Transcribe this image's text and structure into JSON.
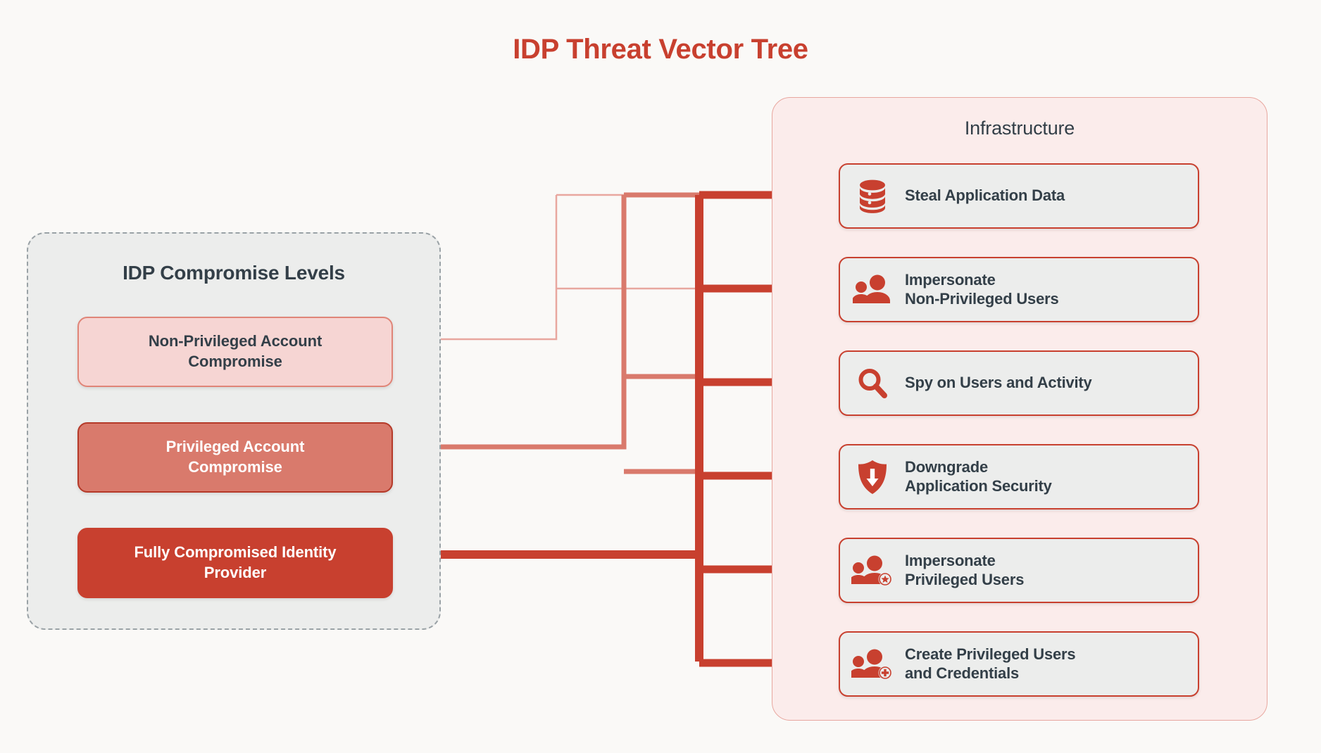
{
  "page": {
    "title": "IDP Threat Vector Tree",
    "background_color": "#faf9f7",
    "accent_color": "#c8402f",
    "text_color": "#333f48"
  },
  "levels_panel": {
    "title": "IDP Compromise Levels",
    "border_style": "dashed",
    "fill_color": "#ecedec",
    "items": [
      {
        "id": "non-privileged-account-compromise",
        "label": "Non-Privileged Account\nCompromise",
        "fill_color": "#f6d5d3",
        "border_color": "#e08578",
        "text_color": "#333f48",
        "severity": 1
      },
      {
        "id": "privileged-account-compromise",
        "label": "Privileged Account\nCompromise",
        "fill_color": "#d97a6c",
        "border_color": "#b53a29",
        "text_color": "#ffffff",
        "severity": 2
      },
      {
        "id": "fully-compromised-identity-provider",
        "label": "Fully Compromised Identity\nProvider",
        "fill_color": "#c8402f",
        "border_color": "#c8402f",
        "text_color": "#ffffff",
        "severity": 3
      }
    ]
  },
  "infrastructure_panel": {
    "title": "Infrastructure",
    "fill_color": "#fbeceb",
    "border_color": "#e8a79f",
    "items": [
      {
        "id": "steal-application-data",
        "label": "Steal Application Data",
        "icon": "database-icon"
      },
      {
        "id": "impersonate-non-privileged-users",
        "label": "Impersonate\nNon-Privileged Users",
        "icon": "users-icon"
      },
      {
        "id": "spy-on-users-and-activity",
        "label": "Spy on Users and Activity",
        "icon": "magnifier-icon"
      },
      {
        "id": "downgrade-application-security",
        "label": "Downgrade\nApplication Security",
        "icon": "shield-down-arrow-icon"
      },
      {
        "id": "impersonate-privileged-users",
        "label": "Impersonate\nPrivileged Users",
        "icon": "users-star-badge-icon"
      },
      {
        "id": "create-privileged-users-and-credentials",
        "label": "Create Privileged Users\nand Credentials",
        "icon": "users-plus-badge-icon"
      }
    ]
  },
  "connections": {
    "legend": [
      {
        "level": "non-privileged-account-compromise",
        "stroke": "#e8a79f",
        "width": 2
      },
      {
        "level": "privileged-account-compromise",
        "stroke": "#d97a6c",
        "width": 7
      },
      {
        "level": "fully-compromised-identity-provider",
        "stroke": "#c8402f",
        "width": 12
      }
    ],
    "arrow_color": "#c8402f"
  }
}
